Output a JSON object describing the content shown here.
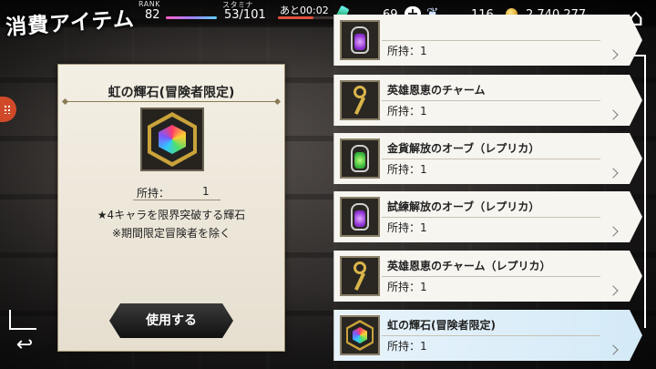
{
  "screen": {
    "title": "消費アイテム"
  },
  "status_bar": {
    "rank_label": "RANK",
    "rank_value": "82",
    "stamina_label": "スタミナ",
    "stamina_value": "53/101",
    "stamina_fraction": 0.52,
    "timer_value": "あと00:02",
    "gems_value": "69",
    "feather_value": "116",
    "gold_value": "2,740,277",
    "icons": [
      "gem-icon",
      "plus-icon",
      "feather-icon",
      "coin-icon",
      "home-icon"
    ]
  },
  "detail": {
    "item_name": "虹の輝石(冒険者限定)",
    "owned_label": "所持：",
    "owned_value": "1",
    "description_line1": "★4キャラを限界突破する輝石",
    "description_line2": "※期間限定冒険者を除く",
    "use_button": "使用する"
  },
  "items": [
    {
      "name": "",
      "owned": "所持：1",
      "thumb": "purple-orb"
    },
    {
      "name": "英雄恩恵のチャーム",
      "owned": "所持：1",
      "thumb": "charm"
    },
    {
      "name": "金貨解放のオーブ（レプリカ）",
      "owned": "所持：1",
      "thumb": "green-orb"
    },
    {
      "name": "試練解放のオーブ（レプリカ）",
      "owned": "所持：1",
      "thumb": "purple-orb"
    },
    {
      "name": "英雄恩恵のチャーム（レプリカ）",
      "owned": "所持：1",
      "thumb": "charm"
    },
    {
      "name": "虹の輝石(冒険者限定)",
      "owned": "所持：1",
      "thumb": "rainbow-gem",
      "selected": true
    }
  ]
}
